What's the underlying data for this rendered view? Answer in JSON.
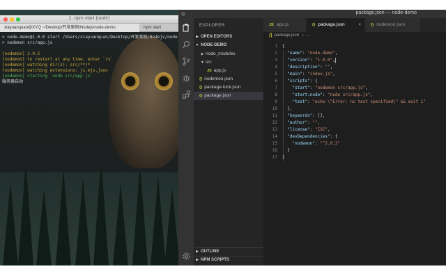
{
  "terminal": {
    "title": "1. npm start (node)",
    "tabs": [
      "xiayuanquan@XYQ ~/Desktop/开发案例/Nodejs/node-demo",
      "npm start"
    ],
    "lines": [
      {
        "text": "> node-demo@1.0.0 start /Users/xiayuanquan/Desktop/开发案例/Nodejs/node-demo",
        "color": "#d8d8d8"
      },
      {
        "text": "> nodemon src/app.js",
        "color": "#d8d8d8"
      },
      {
        "text": "",
        "color": "#d8d8d8"
      },
      {
        "text": "[nodemon] 2.0.2",
        "color": "#c9a93a"
      },
      {
        "text": "[nodemon] to restart at any time, enter `rs`",
        "color": "#c9a93a"
      },
      {
        "text": "[nodemon] watching dir(s): src/**/*",
        "color": "#c9a93a"
      },
      {
        "text": "[nodemon] watching extensions: js,mjs,json",
        "color": "#c9a93a"
      },
      {
        "text": "[nodemon] starting `node src/app.js`",
        "color": "#4fb35c"
      },
      {
        "text": "服务器启动",
        "color": "#d8d8d8"
      }
    ]
  },
  "vscode": {
    "window_title": "package.json — node-demo",
    "sidebar": {
      "header": "EXPLORER",
      "sections": {
        "open_editors": "OPEN EDITORS",
        "project": "NODE-DEMO",
        "outline": "OUTLINE",
        "npm_scripts": "NPM SCRIPTS"
      },
      "tree": [
        {
          "label": "node_modules",
          "kind": "folder-collapsed"
        },
        {
          "label": "src",
          "kind": "folder-open"
        },
        {
          "label": "app.js",
          "kind": "js"
        },
        {
          "label": "nodemon.json",
          "kind": "json"
        },
        {
          "label": "package-lock.json",
          "kind": "json"
        },
        {
          "label": "package.json",
          "kind": "json",
          "selected": true
        }
      ]
    },
    "tabs": [
      {
        "label": "app.js",
        "kind": "js",
        "active": false
      },
      {
        "label": "package.json",
        "kind": "json",
        "active": true,
        "close": "×"
      },
      {
        "label": "nodemon.json",
        "kind": "json",
        "active": false
      }
    ],
    "breadcrumb": {
      "file": "package.json",
      "trail": "..."
    },
    "code_lines": [
      [
        [
          "p",
          "{"
        ]
      ],
      [
        [
          "p",
          "  "
        ],
        [
          "k",
          "\"name\""
        ],
        [
          "p",
          ": "
        ],
        [
          "s",
          "\"node-demo\""
        ],
        [
          "p",
          ","
        ]
      ],
      [
        [
          "p",
          "  "
        ],
        [
          "k",
          "\"version\""
        ],
        [
          "p",
          ": "
        ],
        [
          "s",
          "\"1.0.0\""
        ],
        [
          "p",
          ","
        ]
      ],
      [
        [
          "p",
          "  "
        ],
        [
          "k",
          "\"description\""
        ],
        [
          "p",
          ": "
        ],
        [
          "s",
          "\"\""
        ],
        [
          "p",
          ","
        ]
      ],
      [
        [
          "p",
          "  "
        ],
        [
          "k",
          "\"main\""
        ],
        [
          "p",
          ": "
        ],
        [
          "s",
          "\"index.js\""
        ],
        [
          "p",
          ","
        ]
      ],
      [
        [
          "p",
          "  "
        ],
        [
          "k",
          "\"scripts\""
        ],
        [
          "p",
          ": {"
        ]
      ],
      [
        [
          "p",
          "    "
        ],
        [
          "k",
          "\"start\""
        ],
        [
          "p",
          ": "
        ],
        [
          "s",
          "\"nodemon src/app.js\""
        ],
        [
          "p",
          ","
        ]
      ],
      [
        [
          "p",
          "    "
        ],
        [
          "k",
          "\"start:node\""
        ],
        [
          "p",
          ": "
        ],
        [
          "s",
          "\"node src/app.js\""
        ],
        [
          "p",
          ","
        ]
      ],
      [
        [
          "p",
          "    "
        ],
        [
          "k",
          "\"test\""
        ],
        [
          "p",
          ": "
        ],
        [
          "s",
          "\"echo \\\"Error: no test specified\\\" && exit 1\""
        ]
      ],
      [
        [
          "p",
          "  },"
        ]
      ],
      [
        [
          "p",
          "  "
        ],
        [
          "k",
          "\"keywords\""
        ],
        [
          "p",
          ": [],"
        ]
      ],
      [
        [
          "p",
          "  "
        ],
        [
          "k",
          "\"author\""
        ],
        [
          "p",
          ": "
        ],
        [
          "s",
          "\"\""
        ],
        [
          "p",
          ","
        ]
      ],
      [
        [
          "p",
          "  "
        ],
        [
          "k",
          "\"license\""
        ],
        [
          "p",
          ": "
        ],
        [
          "s",
          "\"ISC\""
        ],
        [
          "p",
          ","
        ]
      ],
      [
        [
          "p",
          "  "
        ],
        [
          "k",
          "\"devDependencies\""
        ],
        [
          "p",
          ": {"
        ]
      ],
      [
        [
          "p",
          "    "
        ],
        [
          "k",
          "\"nodemon\""
        ],
        [
          "p",
          ": "
        ],
        [
          "s",
          "\"^2.0.2\""
        ]
      ],
      [
        [
          "p",
          "  }"
        ]
      ],
      [
        [
          "p",
          "}"
        ]
      ]
    ],
    "activity_icons": [
      "files-icon",
      "search-icon",
      "source-control-icon",
      "debug-icon",
      "extensions-icon",
      "settings-gear-icon"
    ]
  },
  "colors": {
    "editor_bg": "#1e1e1e",
    "sidebar_bg": "#252526",
    "activity_bg": "#333333",
    "json_key": "#9cdcfe",
    "json_string": "#ce9178",
    "nodemon_yellow": "#c9a93a",
    "nodemon_green": "#4fb35c"
  }
}
